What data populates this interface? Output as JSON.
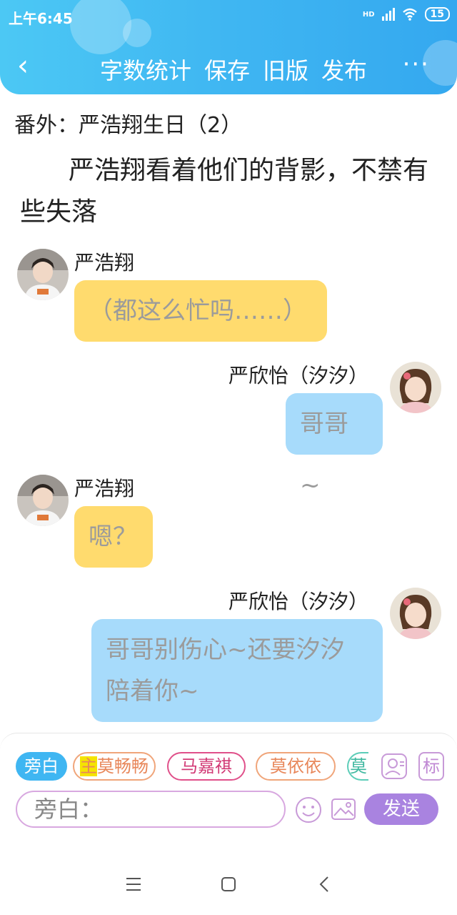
{
  "status": {
    "time": "上午6:45",
    "network": "HD",
    "battery": "15"
  },
  "toolbar": {
    "word_count": "字数统计",
    "save": "保存",
    "old_version": "旧版",
    "publish": "发布",
    "more": "···",
    "back": "‹"
  },
  "chapter_title": "番外：严浩翔生日（2）",
  "narration": "严浩翔看着他们的背影，不禁有些失落",
  "messages": [
    {
      "speaker": "严浩翔",
      "text": "（都这么忙吗……）"
    },
    {
      "speaker": "严欣怡（汐汐）",
      "text": "哥哥~"
    },
    {
      "speaker": "严浩翔",
      "text": "嗯？"
    },
    {
      "speaker": "严欣怡（汐汐）",
      "text": "哥哥别伤心~还要汐汐陪着你~"
    }
  ],
  "roles": {
    "active": "旁白",
    "r1_prefix": "主",
    "r1": "莫畅畅",
    "r2": "马嘉祺",
    "r3": "莫依依",
    "r4": "莫",
    "tag": "标"
  },
  "input": {
    "placeholder": "旁白："
  },
  "send": "发送",
  "colors": {
    "header": "#3fb6f2",
    "left_bubble": "#ffdb6e",
    "right_bubble": "#a7dbfb",
    "send": "#a983e0"
  }
}
